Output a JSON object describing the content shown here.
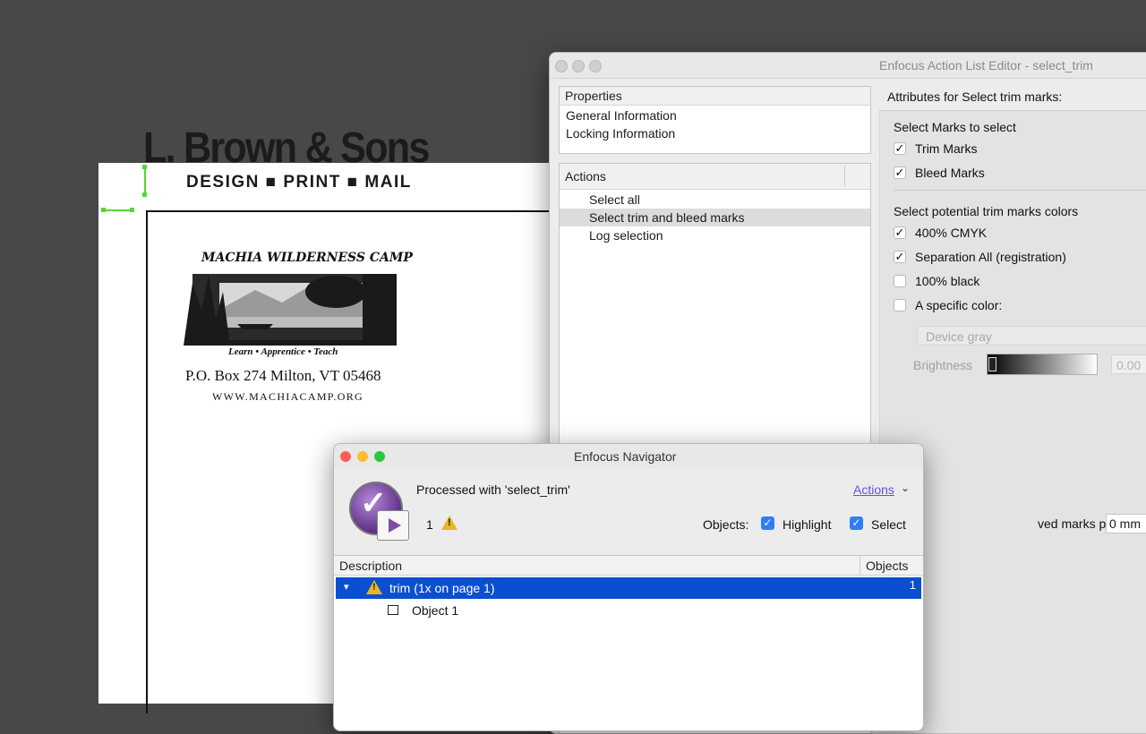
{
  "document": {
    "brand_name": "L. Brown & Sons",
    "brand_sub": "DESIGN ■ PRINT ■ MAIL",
    "camp_title": "MACHIA WILDERNESS CAMP",
    "camp_tagline": "Learn • Apprentice • Teach",
    "camp_address": "P.O. Box 274 Milton, VT 05468",
    "camp_url": "WWW.MACHIACAMP.ORG"
  },
  "action_list_editor": {
    "title": "Enfocus Action List Editor - select_trim",
    "properties_header": "Properties",
    "properties_items": [
      "General Information",
      "Locking Information"
    ],
    "actions_header": "Actions",
    "actions_items": [
      "Select all",
      "Select trim and bleed marks",
      "Log selection"
    ],
    "selected_action_index": 1,
    "attributes_title": "Attributes for Select trim marks:",
    "marks_group_label": "Select Marks to select",
    "marks": [
      {
        "label": "Trim Marks",
        "checked": true
      },
      {
        "label": "Bleed Marks",
        "checked": true
      }
    ],
    "colors_group_label": "Select potential trim marks colors",
    "colors": [
      {
        "label": "400% CMYK",
        "checked": true
      },
      {
        "label": "Separation All (registration)",
        "checked": true
      },
      {
        "label": "100% black",
        "checked": false
      },
      {
        "label": "A specific color:",
        "checked": false
      }
    ],
    "color_space_value": "Device gray",
    "brightness_label": "Brightness",
    "brightness_value": "0.00",
    "deviation_label": "ved marks position deviation:",
    "deviation_value": "0 mm"
  },
  "navigator": {
    "title": "Enfocus Navigator",
    "processed_text": "Processed with 'select_trim'",
    "warning_count": "1",
    "actions_link": "Actions",
    "objects_label": "Objects:",
    "highlight_label": "Highlight",
    "highlight_checked": true,
    "select_label": "Select",
    "select_checked": true,
    "col_description": "Description",
    "col_objects": "Objects",
    "row_label": "trim (1x on page 1)",
    "row_count": "1",
    "child_label": "Object 1"
  },
  "colors": {
    "selection_blue": "#0a4fd1",
    "checkbox_blue": "#2f7ef5",
    "link_purple": "#6b4ee0",
    "warning_yellow": "#e7b820",
    "selection_green": "#5ad43a"
  }
}
